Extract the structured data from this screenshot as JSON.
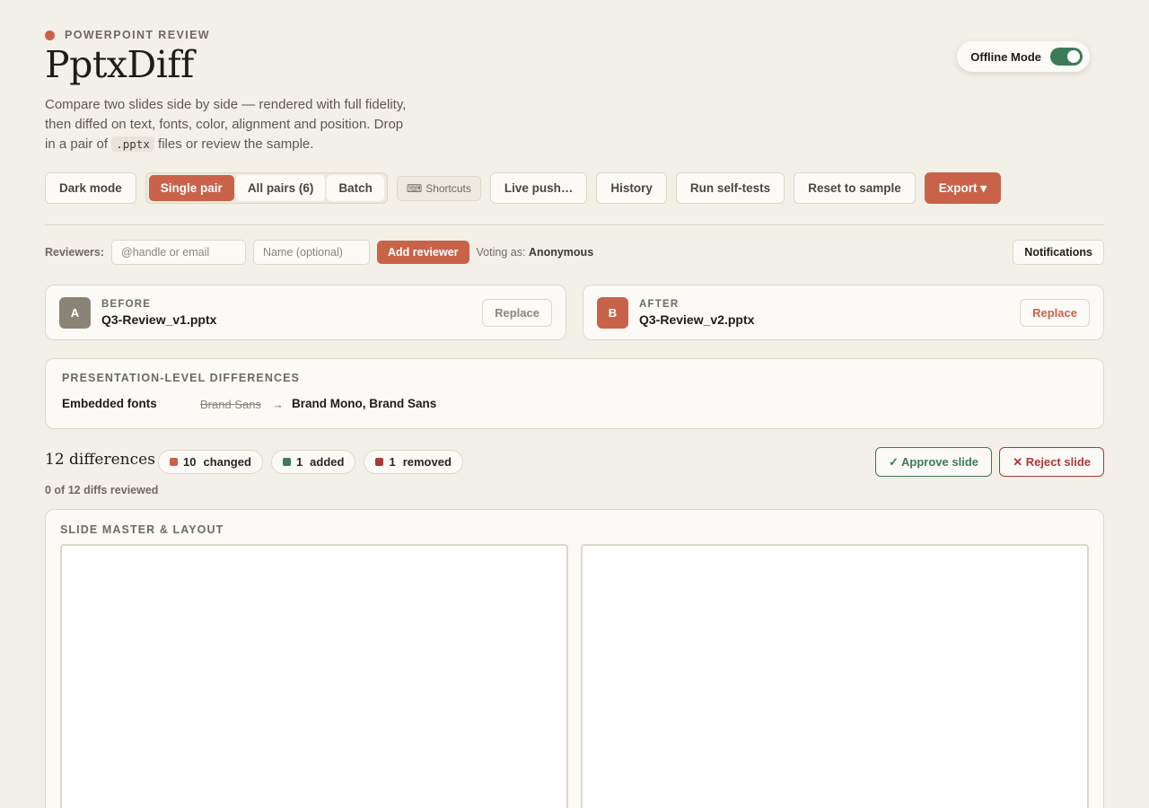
{
  "header": {
    "eyebrow": "POWERPOINT REVIEW",
    "title": "PptxDiff",
    "desc_before": "Compare two slides side by side — rendered with full fidelity, then diffed on text, fonts, color, alignment and position. Drop in a pair of ",
    "desc_code": ".pptx",
    "desc_after": " files or review the sample.",
    "offline_label": "Offline Mode",
    "offline_on": true
  },
  "toolbar": {
    "dark_mode": "Dark mode",
    "modes": [
      "Single pair",
      "All pairs (6)",
      "Batch"
    ],
    "active_mode": "Single pair",
    "shortcuts": "Shortcuts",
    "live_push": "Live push…",
    "history": "History",
    "self_tests": "Run self-tests",
    "reset": "Reset to sample",
    "export": "Export ▾"
  },
  "reviewers": {
    "label": "Reviewers:",
    "handle_placeholder": "@handle or email",
    "name_placeholder": "Name (optional)",
    "add": "Add reviewer",
    "voting_prefix": "Voting as:",
    "voting_name": "Anonymous",
    "notifications": "Notifications"
  },
  "files": {
    "before": {
      "badge": "A",
      "kind": "BEFORE",
      "name": "Q3-Review_v1.pptx",
      "replace": "Replace"
    },
    "after": {
      "badge": "B",
      "kind": "AFTER",
      "name": "Q3-Review_v2.pptx",
      "replace": "Replace"
    }
  },
  "presentation_diffs": {
    "heading": "PRESENTATION-LEVEL DIFFERENCES",
    "rows": [
      {
        "key": "Embedded fonts",
        "old": "Brand Sans",
        "arrow": "→",
        "new": "Brand Mono, Brand Sans"
      }
    ]
  },
  "summary": {
    "count": "12 differences",
    "changed_n": "10",
    "changed_label": "changed",
    "added_n": "1",
    "added_label": "added",
    "removed_n": "1",
    "removed_label": "removed",
    "approve": "✓ Approve slide",
    "reject": "✕ Reject slide",
    "reviewed": "0 of 12 diffs reviewed"
  },
  "master": {
    "heading": "SLIDE MASTER & LAYOUT"
  },
  "colors": {
    "accent": "#c8634a",
    "changed": "#c8634a",
    "added": "#3e7a57",
    "removed": "#a83a3a",
    "background": "#f3f0e8"
  }
}
